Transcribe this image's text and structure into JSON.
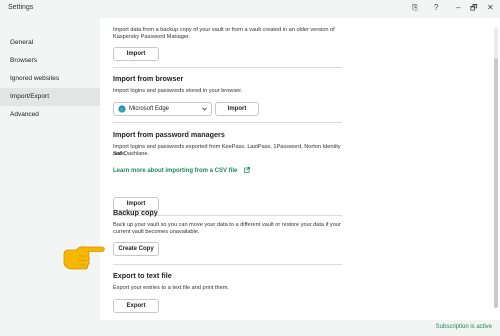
{
  "app": {
    "title": "Settings"
  },
  "window_controls": {
    "restore": "⎘",
    "help": "?",
    "minimize": "–",
    "maximize": "🗗",
    "close": "✕"
  },
  "sidebar": {
    "items": [
      {
        "label": "General"
      },
      {
        "label": "Browsers"
      },
      {
        "label": "Ignored websites"
      },
      {
        "label": "Import/Export"
      },
      {
        "label": "Advanced"
      }
    ]
  },
  "sections": {
    "import_file": {
      "text_line1": "Import data from a backup copy of your vault or from a vault created in an older version of",
      "text_line2": "Kaspersky Password Manager.",
      "button": "Import"
    },
    "import_browser": {
      "title": "Import from browser",
      "text": "Import logins and passwords stored in your browser.",
      "select_value": "Microsoft Edge",
      "button": "Import"
    },
    "import_managers": {
      "title": "Import from password managers",
      "text_line1": "Import logins and passwords exported from KeePass, LastPass, 1Password, Norton Identity Safe,",
      "text_line2": "and Dashlane.",
      "link": "Learn more about importing from a CSV file",
      "button": "Import"
    },
    "backup": {
      "title": "Backup copy",
      "text_line1": "Back up your vault so you can move your data to a different vault or restore your data if your",
      "text_line2": "current vault becomes unavailable.",
      "button": "Create Copy"
    },
    "export": {
      "title": "Export to text file",
      "text": "Export your entries to a text file and print them.",
      "button": "Export"
    }
  },
  "status": {
    "subscription": "Subscription is active"
  },
  "icons": {
    "browser_icon": "edge-icon",
    "pointer_icon": "pointing-hand-icon",
    "external_link_icon": "external-link-icon",
    "dropdown_icon": "chevron-down-icon"
  },
  "colors": {
    "link": "#1b8a5a",
    "status": "#1b8a5a",
    "hand": "#f5b700"
  }
}
